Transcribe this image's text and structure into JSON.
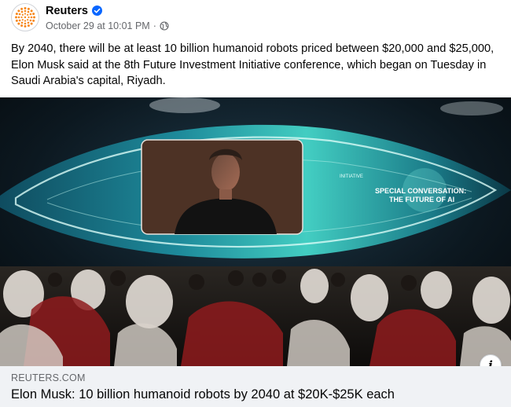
{
  "post": {
    "page_name": "Reuters",
    "timestamp": "October 29 at 10:01 PM",
    "separator": "·",
    "text": "By 2040, there will be at least 10 billion humanoid robots priced between $20,000 and $25,000, Elon Musk said at the 8th Future Investment Initiative conference, which began on Tuesday in Saudi Arabia's capital, Riyadh."
  },
  "media": {
    "screen_text_top": "INITIATIVE",
    "screen_text_line1": "SPECIAL CONVERSATION:",
    "screen_text_line2": "THE FUTURE OF AI"
  },
  "link": {
    "domain": "REUTERS.COM",
    "title": "Elon Musk: 10 billion humanoid robots by 2040 at $20K-$25K each"
  },
  "colors": {
    "brand_orange": "#f7891f",
    "verified_blue": "#0866ff",
    "meta_gray": "#65676b",
    "card_bg": "#f0f2f5",
    "screen_teal": "#2ad1c4"
  },
  "icons": {
    "avatar": "reuters-logo-icon",
    "verified": "verified-badge-icon",
    "audience": "globe-icon",
    "info": "info-icon"
  }
}
